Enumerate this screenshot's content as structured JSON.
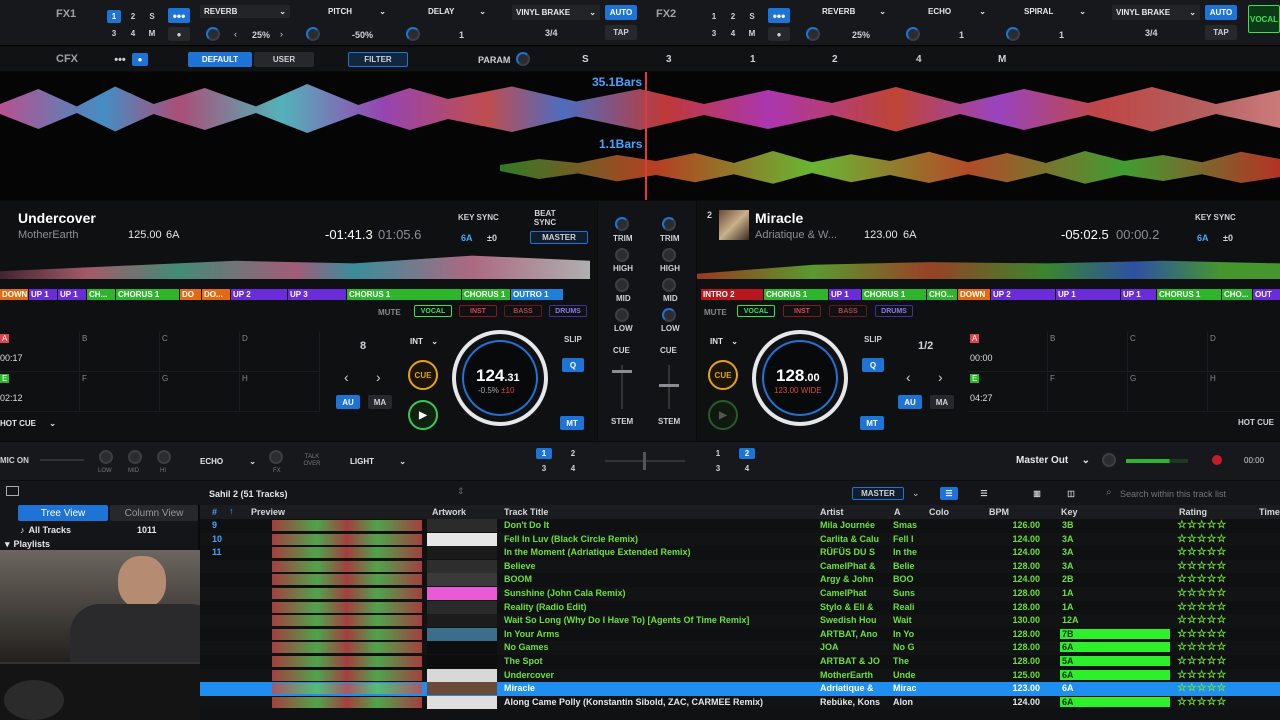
{
  "fx1": {
    "label": "FX1",
    "b1": "1",
    "b2": "2",
    "b3": "S",
    "b4": "3",
    "b5": "4",
    "b6": "M",
    "slots": [
      {
        "name": "REVERB",
        "value": "25%"
      },
      {
        "name": "PITCH",
        "value": "-50%"
      },
      {
        "name": "DELAY",
        "value": "1"
      }
    ],
    "vinyl": "VINYL BRAKE",
    "vinyl_val": "3/4",
    "auto": "AUTO",
    "tap": "TAP"
  },
  "fx2": {
    "label": "FX2",
    "b1": "1",
    "b2": "2",
    "b3": "S",
    "b4": "3",
    "b5": "4",
    "b6": "M",
    "slots": [
      {
        "name": "REVERB",
        "value": "25%"
      },
      {
        "name": "ECHO",
        "value": "1"
      },
      {
        "name": "SPIRAL",
        "value": "1"
      }
    ],
    "vinyl": "VINYL BRAKE",
    "vinyl_val": "3/4",
    "auto": "AUTO",
    "tap": "TAP",
    "vocal": "VOCAL"
  },
  "cfx": {
    "label": "CFX",
    "default": "DEFAULT",
    "user": "USER",
    "filter": "FILTER",
    "param": "PARAM",
    "s": "S",
    "n3": "3",
    "n1": "1",
    "n2": "2",
    "n4": "4",
    "m": "M"
  },
  "wave": {
    "bars1": "35.1Bars",
    "bars2": "1.1Bars"
  },
  "deck1": {
    "title": "Undercover",
    "artist": "MotherEarth",
    "bpm": "125.00",
    "key": "6A",
    "remain": "-01:41.3",
    "elapsed": "01:05.6",
    "keysync": "KEY SYNC",
    "beatsync": "BEAT SYNC",
    "keyval": "6A",
    "keyoff": "±0",
    "master": "MASTER",
    "mute": "MUTE",
    "stems": [
      "VOCAL",
      "INST",
      "BASS",
      "DRUMS"
    ],
    "beatjump": "8",
    "int": "INT",
    "cue": "CUE",
    "slip": "SLIP",
    "q": "Q",
    "au": "AU",
    "ma": "MA",
    "mt": "MT",
    "jog_bpm": "124",
    "jog_dec": ".31",
    "jog_sub": "-0.5%",
    "jog_sub2": "±10",
    "hotcue": "HOT CUE",
    "pad_a": "A",
    "pad_a_t": "00:17",
    "pad_b": "B",
    "pad_c": "C",
    "pad_d": "D",
    "pad_e": "E",
    "pad_e_t": "02:12",
    "pad_f": "F",
    "pad_g": "G",
    "pad_h": "H",
    "segs": [
      "DOWN",
      "UP 1",
      "UP 1",
      "CH...",
      "CHORUS 1",
      "DO",
      "DO...",
      "UP 2",
      "UP 3",
      "CHORUS 1",
      "CHORUS 1",
      "OUTRO 1"
    ]
  },
  "deck2": {
    "num": "2",
    "title": "Miracle",
    "artist": "Adriatique & W...",
    "bpm": "123.00",
    "key": "6A",
    "remain": "-05:02.5",
    "elapsed": "00:00.2",
    "keysync": "KEY SYNC",
    "keyval": "6A",
    "keyoff": "±0",
    "mute": "MUTE",
    "stems": [
      "VOCAL",
      "INST",
      "BASS",
      "DRUMS"
    ],
    "beatjump": "1/2",
    "int": "INT",
    "cue": "CUE",
    "slip": "SLIP",
    "q": "Q",
    "au": "AU",
    "ma": "MA",
    "mt": "MT",
    "jog_bpm": "128",
    "jog_dec": ".00",
    "jog_sub": "123.00",
    "jog_sub2": "WIDE",
    "hotcue": "HOT CUE",
    "pad_a": "A",
    "pad_a_t": "00:00",
    "pad_b": "B",
    "pad_c": "C",
    "pad_d": "D",
    "pad_e": "E",
    "pad_e_t": "04:27",
    "pad_f": "F",
    "pad_g": "G",
    "pad_h": "H",
    "segs": [
      "INTRO 2",
      "CHORUS 1",
      "UP 1",
      "CHORUS 1",
      "CHO...",
      "DOWN",
      "UP 2",
      "UP 1",
      "UP 1",
      "CHORUS 1",
      "CHO...",
      "OUT"
    ]
  },
  "mixer": {
    "trim": "TRIM",
    "high": "HIGH",
    "mid": "MID",
    "low": "LOW",
    "cue": "CUE",
    "stem": "STEM"
  },
  "bottombar": {
    "mic": "MIC ON",
    "low": "LOW",
    "mid": "MID",
    "hi": "HI",
    "echo": "ECHO",
    "fx": "FX",
    "talk": "TALK OVER",
    "light": "LIGHT",
    "d1": "1",
    "d2": "2",
    "d3": "3",
    "d4": "4",
    "e1": "1",
    "e2": "2",
    "e3": "3",
    "e4": "4",
    "master_out": "Master Out",
    "time": "00:00"
  },
  "browser": {
    "playlist": "Sahil 2 (51 Tracks)",
    "master": "MASTER",
    "search_placeholder": "Search within this track list",
    "tree": "Tree View",
    "column": "Column View",
    "all_tracks": "All Tracks",
    "all_count": "1011",
    "playlists": "Playlists"
  },
  "columns": {
    "num": "#",
    "preview": "Preview",
    "artwork": "Artwork",
    "title": "Track Title",
    "artist": "Artist",
    "a": "A",
    "color": "Colo",
    "bpm": "BPM",
    "key": "Key",
    "rating": "Rating",
    "time": "Time"
  },
  "tracks": [
    {
      "n": "9",
      "title": "Don't Do It",
      "artist": "Mila Journée",
      "a": "Smas",
      "bpm": "126.00",
      "key": "3B"
    },
    {
      "n": "10",
      "title": "Fell In Luv (Black Circle Remix)",
      "artist": "Carlita & Calu",
      "a": "Fell I",
      "bpm": "124.00",
      "key": "3A"
    },
    {
      "n": "11",
      "title": "In the Moment (Adriatique Extended Remix)",
      "artist": "RÜFÜS DU S",
      "a": "In the",
      "bpm": "124.00",
      "key": "3A"
    },
    {
      "n": "",
      "title": "Believe",
      "artist": "CamelPhat &",
      "a": "Belie",
      "bpm": "128.00",
      "key": "3A"
    },
    {
      "n": "",
      "title": "BOOM",
      "artist": "Argy & John",
      "a": "BOO",
      "bpm": "124.00",
      "key": "2B"
    },
    {
      "n": "",
      "title": "Sunshine (John Cala Remix)",
      "artist": "CamelPhat",
      "a": "Suns",
      "bpm": "128.00",
      "key": "1A"
    },
    {
      "n": "",
      "title": "Reality (Radio Edit)",
      "artist": "Stylo & Eli &",
      "a": "Reali",
      "bpm": "128.00",
      "key": "1A"
    },
    {
      "n": "",
      "title": "Wait So Long (Why Do I Have To) [Agents Of Time Remix]",
      "artist": "Swedish Hou",
      "a": "Wait",
      "bpm": "130.00",
      "key": "12A"
    },
    {
      "n": "",
      "title": "In Your Arms",
      "artist": "ARTBAT, Ano",
      "a": "In Yo",
      "bpm": "128.00",
      "key": "7B"
    },
    {
      "n": "",
      "title": "No Games",
      "artist": "JOA",
      "a": "No G",
      "bpm": "128.00",
      "key": "6A"
    },
    {
      "n": "",
      "title": "The Spot",
      "artist": "ARTBAT & JO",
      "a": "The",
      "bpm": "128.00",
      "key": "5A"
    },
    {
      "n": "",
      "title": "Undercover",
      "artist": "MotherEarth",
      "a": "Unde",
      "bpm": "125.00",
      "key": "6A"
    },
    {
      "n": "",
      "title": "Miracle",
      "artist": "Adriatique &",
      "a": "Mirac",
      "bpm": "123.00",
      "key": "6A"
    },
    {
      "n": "",
      "title": "Along Came Polly (Konstantin Sibold, ZAC, CARMEE Remix)",
      "artist": "Rebüke, Kons",
      "a": "Alon",
      "bpm": "124.00",
      "key": "6A"
    }
  ],
  "colors": {
    "accent": "#1d73d6",
    "green": "#6de03a",
    "highlight": "#1f8ef1"
  }
}
